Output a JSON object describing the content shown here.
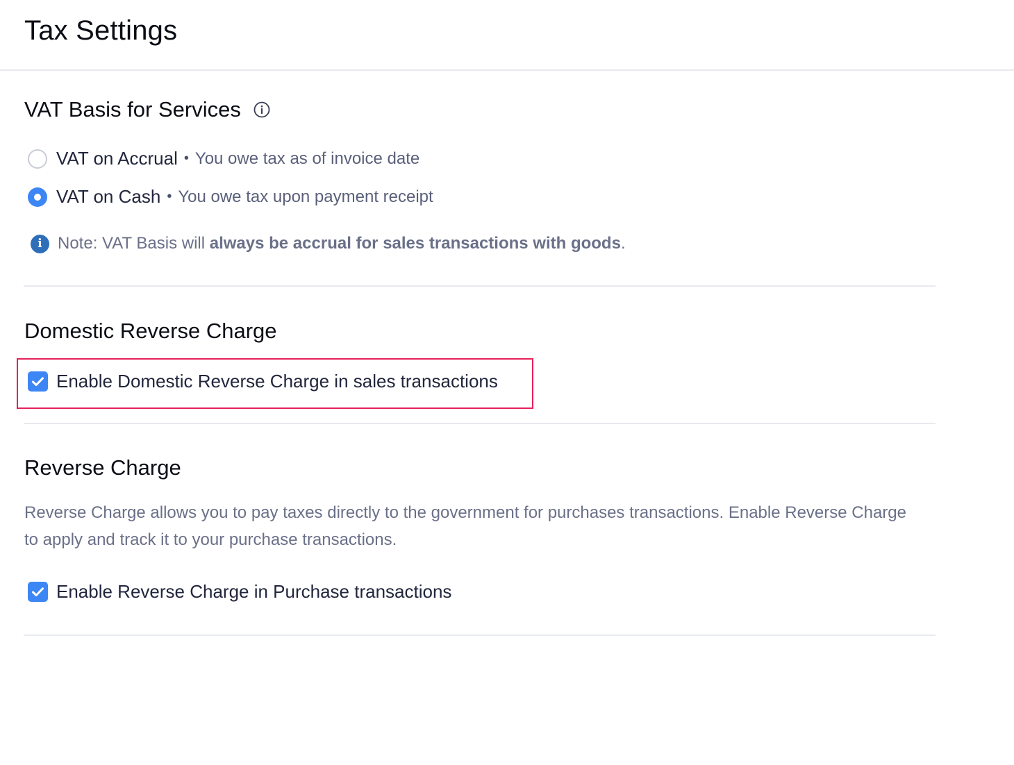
{
  "header": {
    "title": "Tax Settings"
  },
  "vat_basis": {
    "title": "VAT Basis for Services",
    "info_icon": "info-outline-icon",
    "options": [
      {
        "label": "VAT on Accrual",
        "separator": "•",
        "description": "You owe tax as of invoice date",
        "selected": false
      },
      {
        "label": "VAT on Cash",
        "separator": "•",
        "description": "You owe tax upon payment receipt",
        "selected": true
      }
    ],
    "note": {
      "icon": "info-filled-icon",
      "glyph": "i",
      "prefix": "Note: VAT Basis will ",
      "emphasis": "always be accrual for sales transactions with goods",
      "suffix": "."
    }
  },
  "domestic_reverse_charge": {
    "title": "Domestic Reverse Charge",
    "checkbox_label": "Enable Domestic Reverse Charge in sales transactions",
    "checked": true,
    "highlight_color": "#e8205a"
  },
  "reverse_charge": {
    "title": "Reverse Charge",
    "description": "Reverse Charge allows you to pay taxes directly to the government for purchases transactions. Enable Reverse Charge to apply and track it to your purchase transactions.",
    "checkbox_label": "Enable Reverse Charge in Purchase transactions",
    "checked": true
  },
  "colors": {
    "accent": "#3d86f5",
    "divider": "#e8eaf0",
    "info_icon": "#2f6fb7"
  }
}
